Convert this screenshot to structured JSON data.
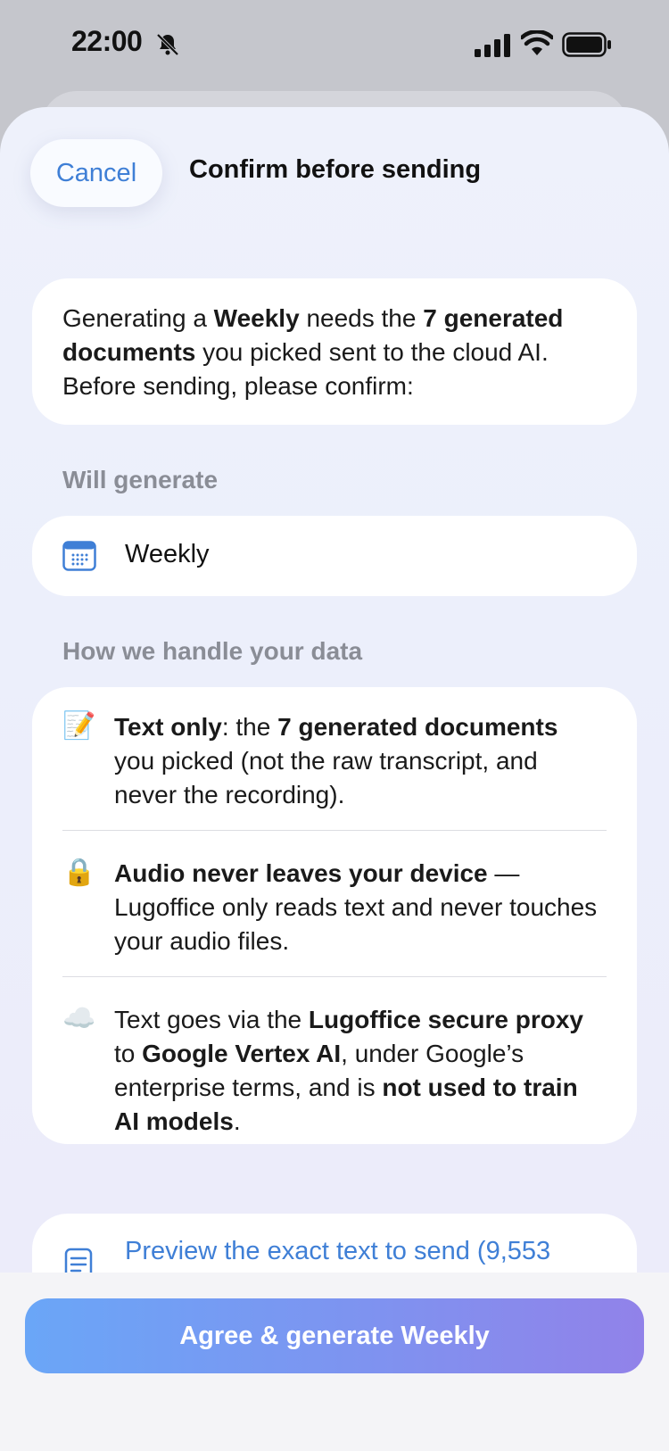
{
  "status_bar": {
    "time": "22:00"
  },
  "header": {
    "cancel_label": "Cancel",
    "title": "Confirm before sending"
  },
  "intro": {
    "t1": "Generating a ",
    "b1": "Weekly",
    "t2": " needs the ",
    "b2": "7 generated documents",
    "t3": " you picked sent to the cloud AI. Before sending, please confirm:"
  },
  "will_generate": {
    "label": "Will generate",
    "item": "Weekly",
    "icon": "calendar-icon"
  },
  "data_handling": {
    "label": "How we handle your data",
    "rows": [
      {
        "icon": "📝",
        "b1": "Text only",
        "t1": ": the ",
        "b2": "7 generated documents",
        "t2": " you picked (not the raw transcript, and never the recording)."
      },
      {
        "icon": "🔒",
        "b1": "Audio never leaves your device",
        "t1": " — Lugoffice only reads text and never touches your audio files."
      },
      {
        "icon": "☁️",
        "t1": "Text goes via the ",
        "b1": "Lugoffice secure proxy",
        "t2": " to ",
        "b2": "Google Vertex AI",
        "t3": ", under Google’s enterprise terms, and is ",
        "b3": "not used to train AI models",
        "t4": "."
      }
    ]
  },
  "preview": {
    "label": "Preview the exact text to send (9,553",
    "icon": "document-icon"
  },
  "agree_button": {
    "label": "Agree & generate Weekly"
  }
}
